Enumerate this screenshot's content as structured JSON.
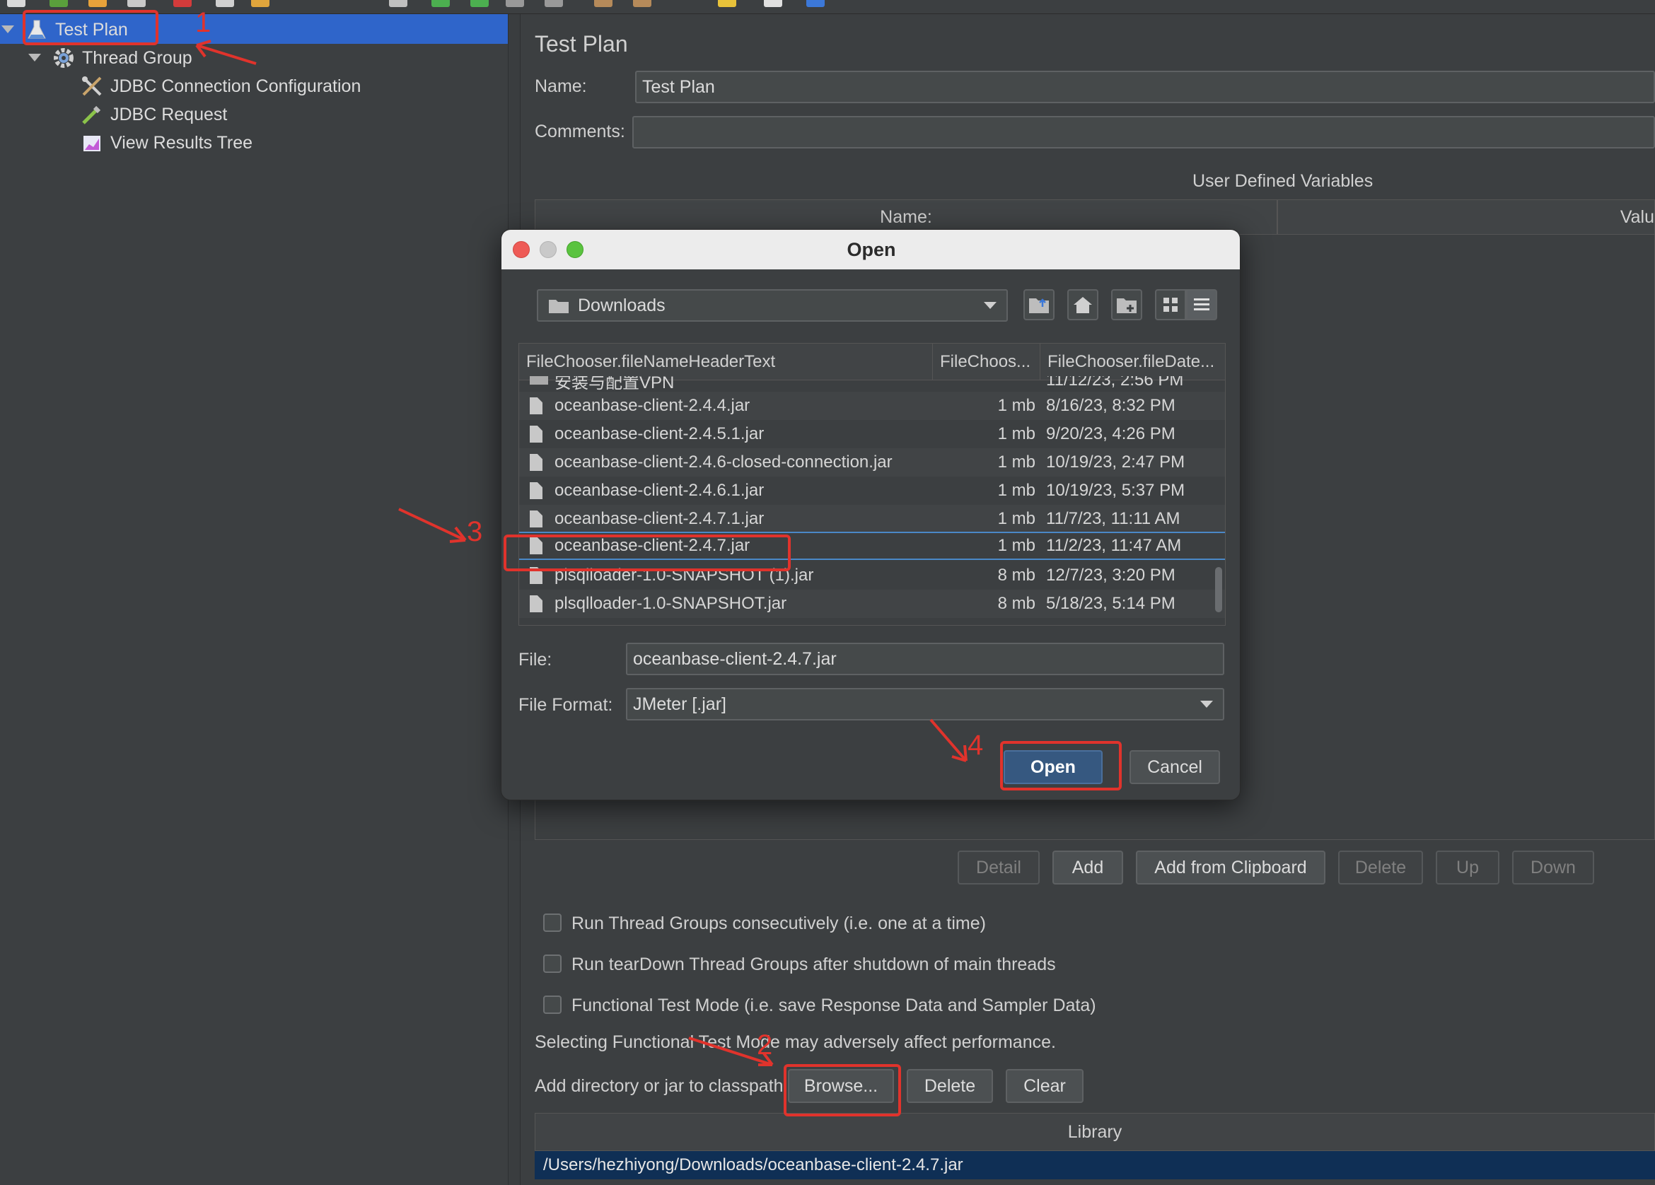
{
  "tree": {
    "items": [
      {
        "label": "Test Plan",
        "icon": "flask-icon"
      },
      {
        "label": "Thread Group",
        "icon": "gear-icon"
      },
      {
        "label": "JDBC Connection Configuration",
        "icon": "tools-icon"
      },
      {
        "label": "JDBC Request",
        "icon": "pipette-icon"
      },
      {
        "label": "View Results Tree",
        "icon": "chart-icon"
      }
    ]
  },
  "panel": {
    "title": "Test Plan",
    "name_label": "Name:",
    "name_value": "Test Plan",
    "comments_label": "Comments:",
    "comments_value": "",
    "udv_title": "User Defined Variables",
    "udv_columns": [
      "Name:",
      "Valu"
    ],
    "buttons": [
      "Detail",
      "Add",
      "Add from Clipboard",
      "Delete",
      "Up",
      "Down"
    ],
    "checkboxes": [
      "Run Thread Groups consecutively (i.e. one at a time)",
      "Run tearDown Thread Groups after shutdown of main threads",
      "Functional Test Mode (i.e. save Response Data and Sampler Data)"
    ],
    "functional_note": "Selecting Functional Test Mode may adversely affect performance.",
    "classpath_label": "Add directory or jar to classpath",
    "classpath_buttons": {
      "browse": "Browse...",
      "delete": "Delete",
      "clear": "Clear"
    },
    "library_header": "Library",
    "library_rows": [
      "/Users/hezhiyong/Downloads/oceanbase-client-2.4.7.jar"
    ]
  },
  "dialog": {
    "title": "Open",
    "folder": "Downloads",
    "columns": [
      "FileChooser.fileNameHeaderText",
      "FileChoos...",
      "FileChooser.fileDate..."
    ],
    "files": [
      {
        "name": "安装与配置VPN",
        "size": "",
        "date": "11/12/23, 2:56 PM"
      },
      {
        "name": "oceanbase-client-2.4.4.jar",
        "size": "1 mb",
        "date": "8/16/23, 8:32 PM"
      },
      {
        "name": "oceanbase-client-2.4.5.1.jar",
        "size": "1 mb",
        "date": "9/20/23, 4:26 PM"
      },
      {
        "name": "oceanbase-client-2.4.6-closed-connection.jar",
        "size": "1 mb",
        "date": "10/19/23, 2:47 PM"
      },
      {
        "name": "oceanbase-client-2.4.6.1.jar",
        "size": "1 mb",
        "date": "10/19/23, 5:37 PM"
      },
      {
        "name": "oceanbase-client-2.4.7.1.jar",
        "size": "1 mb",
        "date": "11/7/23, 11:11 AM"
      },
      {
        "name": "oceanbase-client-2.4.7.jar",
        "size": "1 mb",
        "date": "11/2/23, 11:47 AM"
      },
      {
        "name": "plsqlloader-1.0-SNAPSHOT (1).jar",
        "size": "8 mb",
        "date": "12/7/23, 3:20 PM"
      },
      {
        "name": "plsqlloader-1.0-SNAPSHOT.jar",
        "size": "8 mb",
        "date": "5/18/23, 5:14 PM"
      }
    ],
    "file_label": "File:",
    "file_value": "oceanbase-client-2.4.7.jar",
    "format_label": "File Format:",
    "format_value": "JMeter [.jar]",
    "open_button": "Open",
    "cancel_button": "Cancel"
  },
  "annotations": [
    "1",
    "2",
    "3",
    "4"
  ],
  "colors": {
    "annotation": "#e0332c",
    "selection": "#2f65ca",
    "open_button": "#365880"
  }
}
